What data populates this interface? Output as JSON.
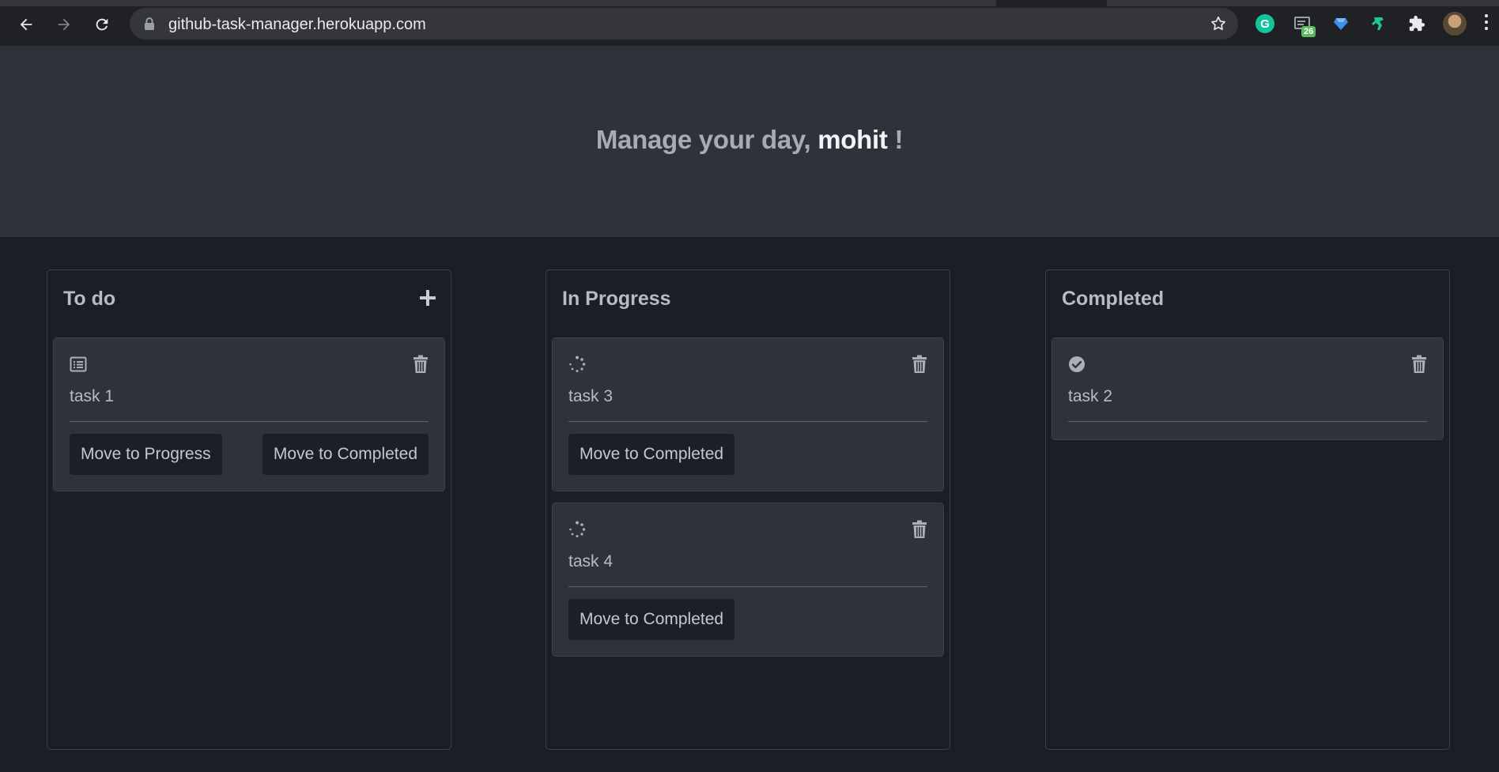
{
  "browser": {
    "url": "github-task-manager.herokuapp.com",
    "extension_badge": "26"
  },
  "header": {
    "greeting_prefix": "Manage your day,",
    "username": "mohit",
    "greeting_suffix": "!"
  },
  "columns": [
    {
      "title": "To do",
      "cards": [
        {
          "name": "task 1",
          "status_icon": "list-icon",
          "buttons": [
            "Move to Progress",
            "Move to Completed"
          ]
        }
      ]
    },
    {
      "title": "In Progress",
      "cards": [
        {
          "name": "task 3",
          "status_icon": "spinner-icon",
          "buttons": [
            "Move to Completed"
          ]
        },
        {
          "name": "task 4",
          "status_icon": "spinner-icon",
          "buttons": [
            "Move to Completed"
          ]
        }
      ]
    },
    {
      "title": "Completed",
      "cards": [
        {
          "name": "task 2",
          "status_icon": "check-circle-icon",
          "buttons": []
        }
      ]
    }
  ],
  "colors": {
    "page_background": "#1b1e24",
    "hero_background": "#2e333b",
    "card_background": "#2e333b",
    "button_background": "#1c1f25",
    "username_color": "#f2f3f5"
  }
}
